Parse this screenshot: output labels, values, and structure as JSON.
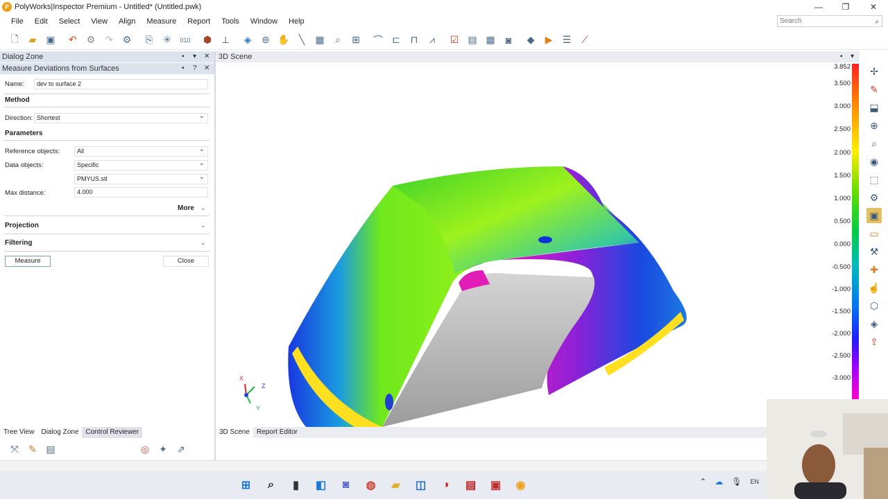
{
  "window": {
    "title": "PolyWorks|Inspector Premium - Untitled* (Untitled.pwk)",
    "min_glyph": "—",
    "restore_glyph": "❐",
    "close_glyph": "✕"
  },
  "menu": [
    "File",
    "Edit",
    "Select",
    "View",
    "Align",
    "Measure",
    "Report",
    "Tools",
    "Window",
    "Help"
  ],
  "search": {
    "placeholder": "Search"
  },
  "toolbar_icons": [
    "new-file-icon",
    "open-folder-icon",
    "save-icon",
    "undo-icon",
    "redo-gear-icon",
    "redo-icon",
    "settings-icon",
    "import-icon",
    "points-icon",
    "binary-icon",
    "probe-icon",
    "align-icon",
    "cube-icon",
    "scan-icon",
    "hand-icon",
    "measure-line-icon",
    "grid-icon",
    "zoom-icon",
    "table-icon",
    "tube-icon",
    "clamp-icon",
    "caliper-icon",
    "compass-icon",
    "checklist-icon",
    "report-icon",
    "spreadsheet-icon",
    "camera-icon",
    "macro-icon",
    "play-icon",
    "sequence-icon",
    "chart-icon"
  ],
  "dialog_zone": {
    "title": "Dialog Zone",
    "subtitle": "Measure Deviations from Surfaces",
    "name_label": "Name:",
    "name_value": "dev to surface 2",
    "method_section": "Method",
    "direction_label": "Direction:",
    "direction_value": "Shortest",
    "parameters_section": "Parameters",
    "reference_label": "Reference objects:",
    "reference_value": "All",
    "data_label": "Data objects:",
    "data_value": "Specific",
    "data_object_value": "PMYUS.stl",
    "max_distance_label": "Max distance:",
    "max_distance_value": "4.000",
    "more_label": "More",
    "projection_section": "Projection",
    "filtering_section": "Filtering",
    "measure_button": "Measure",
    "close_button": "Close"
  },
  "left_tabs": [
    "Tree View",
    "Dialog Zone",
    "Control Reviewer"
  ],
  "scene": {
    "title": "3D Scene",
    "tabs": [
      "3D Scene",
      "Report Editor"
    ],
    "axes": {
      "x": "X",
      "y": "Y",
      "z": "Z"
    }
  },
  "legend": [
    "3.852",
    "3.500",
    "3.000",
    "2.500",
    "2.000",
    "1.500",
    "1.000",
    "0.500",
    "0.000",
    "-0.500",
    "-1.000",
    "-1.500",
    "-2.000",
    "-2.500",
    "-3.000"
  ],
  "right_tools": [
    "view-fit-icon",
    "pick-icon",
    "align-surface-icon",
    "zoom-view-icon",
    "zoom-search-icon",
    "eye-icon",
    "cube-frame-icon",
    "gear-view-icon",
    "color-map-icon",
    "comment-icon",
    "tool-icon",
    "annotation-icon",
    "hand-pointer-icon",
    "shape-icon",
    "layer-icon",
    "export-icon"
  ],
  "taskbar": {
    "lang": "EN"
  }
}
